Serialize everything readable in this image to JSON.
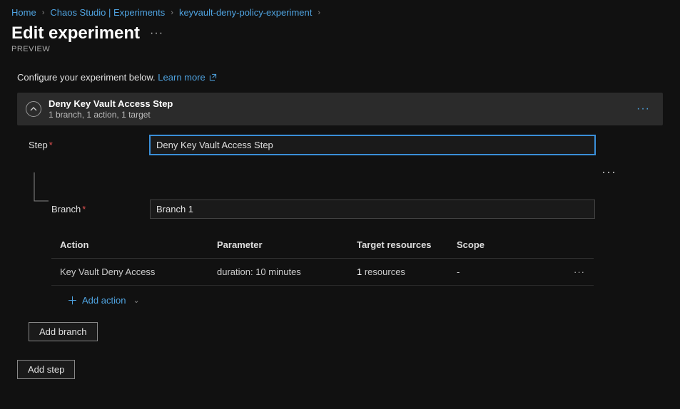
{
  "breadcrumb": {
    "home": "Home",
    "studio": "Chaos Studio | Experiments",
    "experiment": "keyvault-deny-policy-experiment"
  },
  "page": {
    "title": "Edit experiment",
    "subtitle": "PREVIEW",
    "instruction": "Configure your experiment below.",
    "learn_more": "Learn more"
  },
  "step": {
    "header_title": "Deny Key Vault Access Step",
    "header_sub": "1 branch, 1 action, 1 target",
    "step_label": "Step",
    "step_value": "Deny Key Vault Access Step",
    "branch_label": "Branch",
    "branch_value": "Branch 1"
  },
  "table": {
    "cols": {
      "action": "Action",
      "parameter": "Parameter",
      "targets": "Target resources",
      "scope": "Scope"
    },
    "row": {
      "action": "Key Vault Deny Access",
      "parameter": "duration: 10 minutes",
      "targets_count": "1",
      "targets_suffix": " resources",
      "scope": "-"
    }
  },
  "buttons": {
    "add_action": "Add action",
    "add_branch": "Add branch",
    "add_step": "Add step"
  }
}
